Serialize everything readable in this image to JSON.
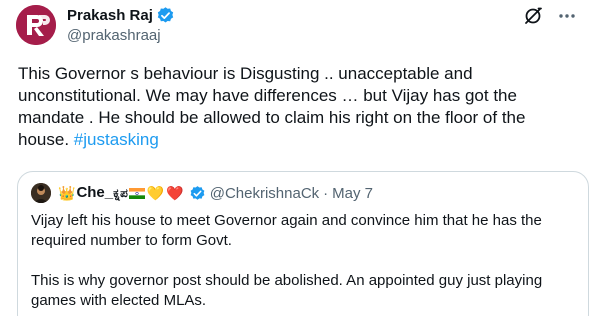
{
  "author": {
    "display_name": "Prakash Raj",
    "handle": "@prakashraaj",
    "avatar_icon": "pr-monogram-logo",
    "avatar_color": "#a51d4a",
    "verified": true
  },
  "actions": {
    "grok_icon": "grok-icon",
    "more_icon": "more-icon"
  },
  "tweet": {
    "text": "This Governor s behaviour is Disgusting .. unacceptable and unconstitutional. We may have differences … but Vijay has got the mandate . He should be allowed to claim his right on the floor of the house.",
    "hashtag": "#justasking",
    "hashtag_color": "#1d9bf0"
  },
  "quote": {
    "display_name_prefix": "Che_",
    "display_name_kannada": "ಕ್ನಪ",
    "crown_emoji": "👑",
    "yellow_heart": "💛",
    "red_heart": "❤️",
    "verified": true,
    "handle": "@ChekrishnaCk",
    "separator": "·",
    "date": "May 7",
    "paragraph1": "Vijay left his house to meet Governor again and convince him that he has the required number to form Govt.",
    "paragraph2": "This is why governor post should be abolished. An appointed guy just playing games with elected MLAs."
  },
  "colors": {
    "verified_blue": "#1d9bf0",
    "secondary_text": "#536471",
    "border": "#cfd9de"
  }
}
